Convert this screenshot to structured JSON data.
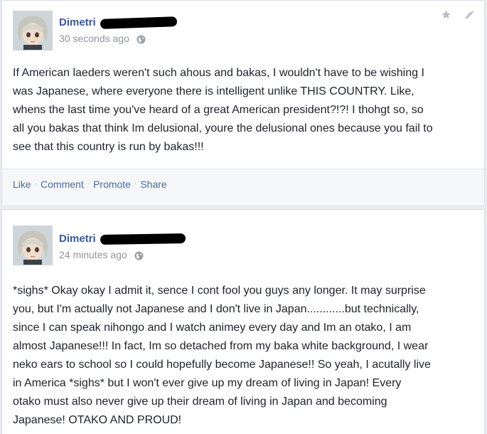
{
  "posts": [
    {
      "author": "Dimetri",
      "timestamp": "30 seconds ago",
      "text": "If American laeders weren't such ahous and bakas, I wouldn't have to be wishing I\nwas Japanese, where everyone there is intelligent unlike THIS COUNTRY. Like,\nwhens the last time you've heard of a great American president?!?! I thohgt so, so\nall you bakas that think Im delusional, youre the delusional ones because you fail to\nsee that this country is run by bakas!!!",
      "actions": [
        "Like",
        "Comment",
        "Promote",
        "Share"
      ]
    },
    {
      "author": "Dimetri",
      "timestamp": "24 minutes ago",
      "text": "*sighs* Okay okay I admit it, sence I cont fool you guys any longer. It may surprise\nyou, but I'm actually not Japanese and I don't live in Japan............but technically,\nsince I can speak nihongo and I watch animey every day and Im an otako, I am\nalmost Japanese!!! In fact, Im so detached from my baka white background, I wear\nneko ears to school so I could hopefully become Japanese!! So yeah, I acutally live\nin America *sighs* but I won't ever give up my dream of living in Japan! Every\notako must also never give up their dream of living in Japan and becoming\nJapanese! OTAKO AND PROUD!"
    }
  ],
  "icons": {
    "privacy": "globe-icon",
    "favorite": "star-icon",
    "edit": "pencil-icon"
  },
  "colors": {
    "link": "#3b5998",
    "action_link": "#4b67a1",
    "muted": "#90949c",
    "background": "#e9ebee"
  }
}
